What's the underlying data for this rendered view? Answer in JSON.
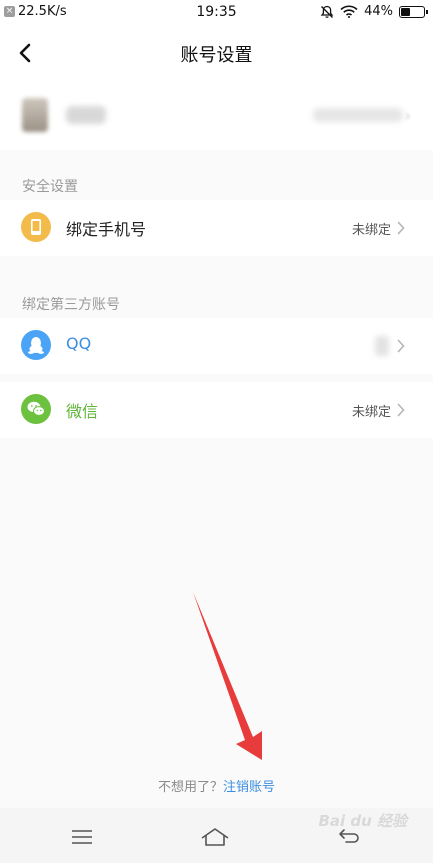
{
  "status_bar": {
    "net_speed": "22.5K/s",
    "time": "19:35",
    "battery": "44%",
    "battery_level": 0.44
  },
  "header": {
    "title": "账号设置"
  },
  "sections": {
    "security": {
      "title": "安全设置",
      "phone_label": "绑定手机号",
      "phone_status": "未绑定"
    },
    "third_party": {
      "title": "绑定第三方账号",
      "qq_label": "QQ",
      "wechat_label": "微信",
      "wechat_status": "未绑定"
    }
  },
  "footer": {
    "prompt": "不想用了？",
    "link": "注销账号"
  },
  "watermark": "Bai du 经验",
  "colors": {
    "phone_icon": "#f2bb4a",
    "qq_icon": "#4aa3f5",
    "qq_text": "#3d8fe0",
    "wechat_icon": "#6cc13e",
    "wechat_text": "#5fb43a",
    "link": "#3d8fe0",
    "arrow": "#e83b3b"
  },
  "icons": {
    "back": "chevron-left-icon",
    "phone": "phone-icon",
    "qq": "qq-penguin-icon",
    "wechat": "wechat-icon",
    "menu": "menu-icon",
    "home": "home-icon",
    "back_nav": "back-nav-icon"
  }
}
